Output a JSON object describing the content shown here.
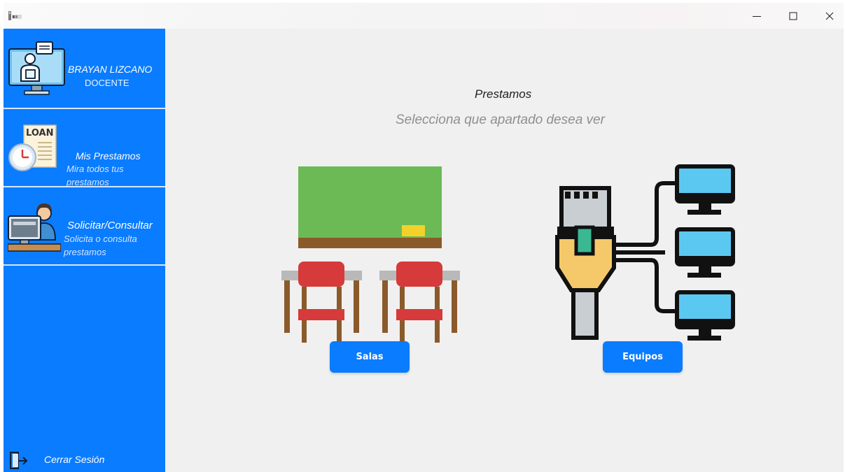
{
  "window": {
    "app_icon": "app-icon",
    "controls": [
      "minimize-icon",
      "maximize-icon",
      "close-icon"
    ]
  },
  "sidebar": {
    "user": {
      "name": "BRAYAN LIZCANO",
      "role": "DOCENTE",
      "icon": "teacher-monitor-icon"
    },
    "items": [
      {
        "title": "Mis Prestamos",
        "subtitle": "Mira todos tus prestamos",
        "icon": "loan-document-icon"
      },
      {
        "title": "Solicitar/Consultar",
        "subtitle": "Solicita o consulta prestamos",
        "icon": "person-computer-icon"
      }
    ],
    "logout": {
      "label": "Cerrar Sesión",
      "icon": "logout-icon"
    }
  },
  "main": {
    "title": "Prestamos",
    "subtitle": "Selecciona que apartado desea ver",
    "options": [
      {
        "label": "Salas",
        "icon": "classroom-icon"
      },
      {
        "label": "Equipos",
        "icon": "network-computers-icon"
      }
    ]
  },
  "colors": {
    "sidebar": "#0a7cff",
    "content_bg": "#f0f0f0",
    "button": "#0a7cff",
    "board": "#6cba56",
    "chair": "#d63a3a",
    "screen": "#5bc8f2"
  }
}
